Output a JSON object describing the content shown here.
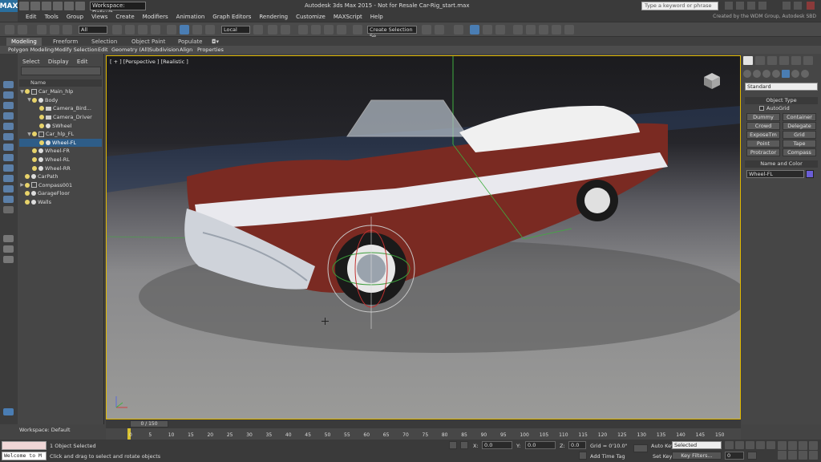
{
  "titlebar": {
    "logo": "MAX",
    "workspace": "Workspace: Default",
    "app_title": "Autodesk 3ds Max  2015   -  Not for Resale     Car-Rig_start.max",
    "search_placeholder": "Type a keyword or phrase"
  },
  "menu": {
    "items": [
      "Edit",
      "Tools",
      "Group",
      "Views",
      "Create",
      "Modifiers",
      "Animation",
      "Graph Editors",
      "Rendering",
      "Customize",
      "MAXScript",
      "Help"
    ],
    "brand_note": "Created by the WDM Group, Autodesk SBD"
  },
  "toolbar": {
    "filter": "All",
    "refcoord": "Local",
    "selection_set": "Create Selection Se"
  },
  "ribbon": {
    "tabs": [
      "Modeling",
      "Freeform",
      "Selection",
      "Object Paint",
      "Populate"
    ],
    "sub": [
      "Polygon Modeling",
      "Modify Selection",
      "Edit",
      "Geometry (All)",
      "Subdivision",
      "Align",
      "Properties"
    ]
  },
  "scene_explorer": {
    "tabs": [
      "Select",
      "Display",
      "Edit"
    ],
    "column": "Name",
    "items": [
      {
        "label": "Car_Main_hlp",
        "level": 0,
        "expander": "▼",
        "type": "hlp",
        "selected": false
      },
      {
        "label": "Body",
        "level": 1,
        "expander": "▼",
        "type": "dot",
        "selected": false
      },
      {
        "label": "Camera_Bird...",
        "level": 2,
        "expander": "",
        "type": "cam",
        "selected": false
      },
      {
        "label": "Camera_Driver",
        "level": 2,
        "expander": "",
        "type": "cam",
        "selected": false
      },
      {
        "label": "SWheel",
        "level": 2,
        "expander": "",
        "type": "dot",
        "selected": false
      },
      {
        "label": "Car_hlp_FL",
        "level": 1,
        "expander": "▼",
        "type": "hlp",
        "selected": false
      },
      {
        "label": "Wheel-FL",
        "level": 2,
        "expander": "",
        "type": "dot",
        "selected": true
      },
      {
        "label": "Wheel-FR",
        "level": 1,
        "expander": "",
        "type": "dot",
        "selected": false
      },
      {
        "label": "Wheel-RL",
        "level": 1,
        "expander": "",
        "type": "dot",
        "selected": false
      },
      {
        "label": "Wheel-RR",
        "level": 1,
        "expander": "",
        "type": "dot",
        "selected": false
      },
      {
        "label": "CarPath",
        "level": 0,
        "expander": "",
        "type": "dot",
        "selected": false
      },
      {
        "label": "Compass001",
        "level": 0,
        "expander": "▶",
        "type": "hlp",
        "selected": false
      },
      {
        "label": "GarageFloor",
        "level": 0,
        "expander": "",
        "type": "dot",
        "selected": false
      },
      {
        "label": "Walls",
        "level": 0,
        "expander": "",
        "type": "dot",
        "selected": false
      }
    ],
    "workspace_label": "Workspace: Default"
  },
  "viewport": {
    "label": "[ + ] [Perspective ] [Realistic ]"
  },
  "command_panel": {
    "dropdown": "Standard",
    "object_type_title": "Object Type",
    "autogrid": "AutoGrid",
    "buttons": [
      "Dummy",
      "Container",
      "Crowd",
      "Delegate",
      "ExposeTm",
      "Grid",
      "Point",
      "Tape",
      "Protractor",
      "Compass"
    ],
    "name_color_title": "Name and Color",
    "name_value": "Wheel-FL",
    "object_color": "#6b5ed6"
  },
  "timeline": {
    "slider": "0 / 150",
    "ticks": [
      "0",
      "5",
      "10",
      "15",
      "20",
      "25",
      "30",
      "35",
      "40",
      "45",
      "50",
      "55",
      "60",
      "65",
      "70",
      "75",
      "80",
      "85",
      "90",
      "95",
      "100",
      "105",
      "110",
      "115",
      "120",
      "125",
      "130",
      "135",
      "140",
      "145",
      "150"
    ]
  },
  "status": {
    "listener_text": "Welcome to M",
    "selected_count": "1 Object Selected",
    "prompt": "Click and drag to select and rotate objects",
    "x_label": "X:",
    "x_value": "0.0",
    "y_label": "Y:",
    "y_value": "0.0",
    "z_label": "Z:",
    "z_value": "0.0",
    "grid": "Grid = 0'10.0\"",
    "add_time_tag": "Add Time Tag",
    "auto_key": "Auto Key",
    "set_key": "Set Key",
    "key_mode": "Selected",
    "key_filters": "Key Filters...",
    "frame": "0"
  },
  "colors": {
    "accent": "#4a7db3",
    "viewport_border": "#e0b800",
    "selection": "#2e5d88"
  }
}
